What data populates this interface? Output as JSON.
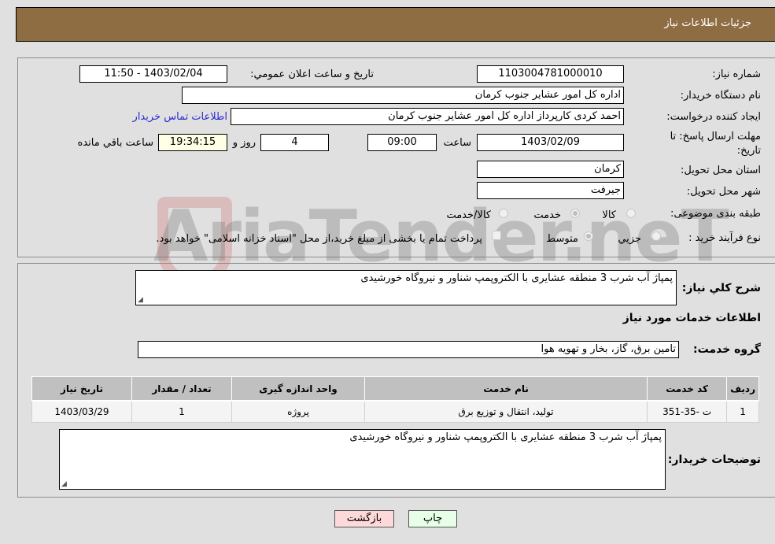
{
  "header": {
    "title": "جزئیات اطلاعات نیاز"
  },
  "details": {
    "need_number": {
      "label": "شماره نیاز:",
      "value": "1103004781000010"
    },
    "announce_datetime": {
      "label": "تاریخ و ساعت اعلان عمومي:",
      "value": "1403/02/04 - 11:50"
    },
    "buyer_org": {
      "label": "نام دستگاه خریدار:",
      "value": "اداره کل امور عشایر جنوب کرمان"
    },
    "requester": {
      "label": "ایجاد کننده درخواست:",
      "value": "احمد کردی   کارپرداز اداره کل امور عشایر جنوب کرمان"
    },
    "buyer_contact_link": "اطلاعات تماس خریدار",
    "deadline": {
      "label": "مهلت ارسال پاسخ: تا تاریخ:",
      "date": "1403/02/09",
      "time_label": "ساعت",
      "time": "09:00",
      "days": "4",
      "days_label": "روز و",
      "remaining": "19:34:15",
      "remaining_label": "ساعت باقي مانده"
    },
    "province": {
      "label": "استان محل تحویل:",
      "value": "کرمان"
    },
    "city": {
      "label": "شهر محل تحویل:",
      "value": "جیرفت"
    },
    "category": {
      "label": "طبقه بندی موضوعی:",
      "options": [
        "کالا",
        "خدمت",
        "کالا/خدمت"
      ],
      "selected": "خدمت"
    },
    "purchase_type": {
      "label": "نوع فرآیند خرید :",
      "options": [
        "جزيي",
        "متوسط"
      ],
      "selected": "متوسط",
      "treasury_note": "پرداخت تمام یا بخشی از مبلغ خرید،از محل \"اسناد خزانه اسلامی\" خواهد بود."
    }
  },
  "summary": {
    "label": "شرح كلي نياز:",
    "value": "پمپاژ آب شرب 3 منطقه عشایری با الکتروپمپ شناور و نیروگاه خورشیدی"
  },
  "services_section_title": "اطلاعات خدمات مورد نیاز",
  "service_group": {
    "label": "گروه خدمت:",
    "value": "تامین برق، گاز، بخار و تهویه هوا"
  },
  "table": {
    "headers": [
      "ردیف",
      "کد خدمت",
      "نام خدمت",
      "واحد اندازه گیری",
      "تعداد / مقدار",
      "تاریخ نیاز"
    ],
    "rows": [
      [
        "1",
        "ت -35-351",
        "تولید، انتقال و توزیع برق",
        "پروژه",
        "1",
        "1403/03/29"
      ]
    ]
  },
  "buyer_notes": {
    "label": "توضیحات خریدار:",
    "value": "پمپاژ آب شرب 3 منطقه عشایری با الکتروپمپ شناور و نیروگاه خورشیدی"
  },
  "buttons": {
    "print": "چاپ",
    "back": "بازگشت"
  },
  "watermark": "AriaTender.neT"
}
